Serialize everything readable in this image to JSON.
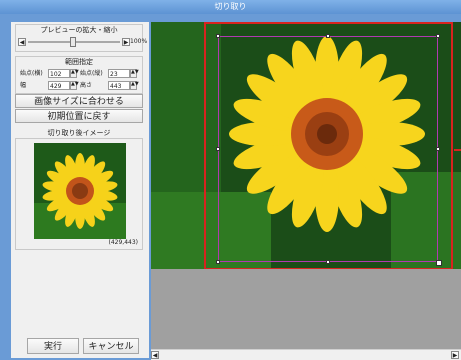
{
  "window": {
    "title": "切り取り"
  },
  "zoom": {
    "label": "プレビューの拡大・縮小",
    "value": "100%",
    "left_arrow": "◀",
    "right_arrow": "▶"
  },
  "range": {
    "label": "範囲指定",
    "start_x_label": "始点(横)",
    "start_x": "102",
    "start_y_label": "始点(縦)",
    "start_y": "23",
    "width_label": "幅",
    "width": "429",
    "height_label": "高さ",
    "height": "443"
  },
  "buttons": {
    "fit_image": "画像サイズに合わせる",
    "reset_position": "初期位置に戻す",
    "execute": "実行",
    "cancel": "キャンセル"
  },
  "preview": {
    "label": "切り取り後イメージ",
    "size": "(429,443)"
  },
  "scroll": {
    "left": "◀",
    "right": "▶"
  }
}
